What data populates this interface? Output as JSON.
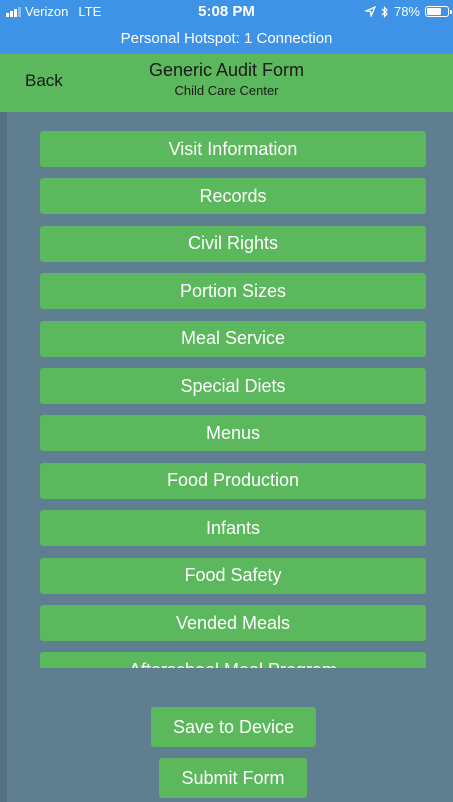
{
  "status_bar": {
    "carrier": "Verizon",
    "network": "LTE",
    "time": "5:08 PM",
    "battery": "78%",
    "battery_level": 0.78,
    "hotspot": "Personal Hotspot: 1 Connection",
    "icons": [
      "signal-icon",
      "location-arrow-icon",
      "bluetooth-icon",
      "battery-icon"
    ]
  },
  "nav": {
    "back_label": "Back",
    "title": "Generic Audit Form",
    "subtitle": "Child Care Center"
  },
  "sections": [
    {
      "label": "Visit Information"
    },
    {
      "label": "Records"
    },
    {
      "label": "Civil Rights"
    },
    {
      "label": "Portion Sizes"
    },
    {
      "label": "Meal Service"
    },
    {
      "label": "Special Diets"
    },
    {
      "label": "Menus"
    },
    {
      "label": "Food Production"
    },
    {
      "label": "Infants"
    },
    {
      "label": "Food Safety"
    },
    {
      "label": "Vended Meals"
    },
    {
      "label": "Afterschool Meal Program"
    }
  ],
  "actions": {
    "save_label": "Save to Device",
    "submit_label": "Submit Form"
  },
  "colors": {
    "status_bar": "#3e93e6",
    "nav_bar": "#5cb85c",
    "button": "#5cb85c",
    "background": "#5f7f91"
  }
}
